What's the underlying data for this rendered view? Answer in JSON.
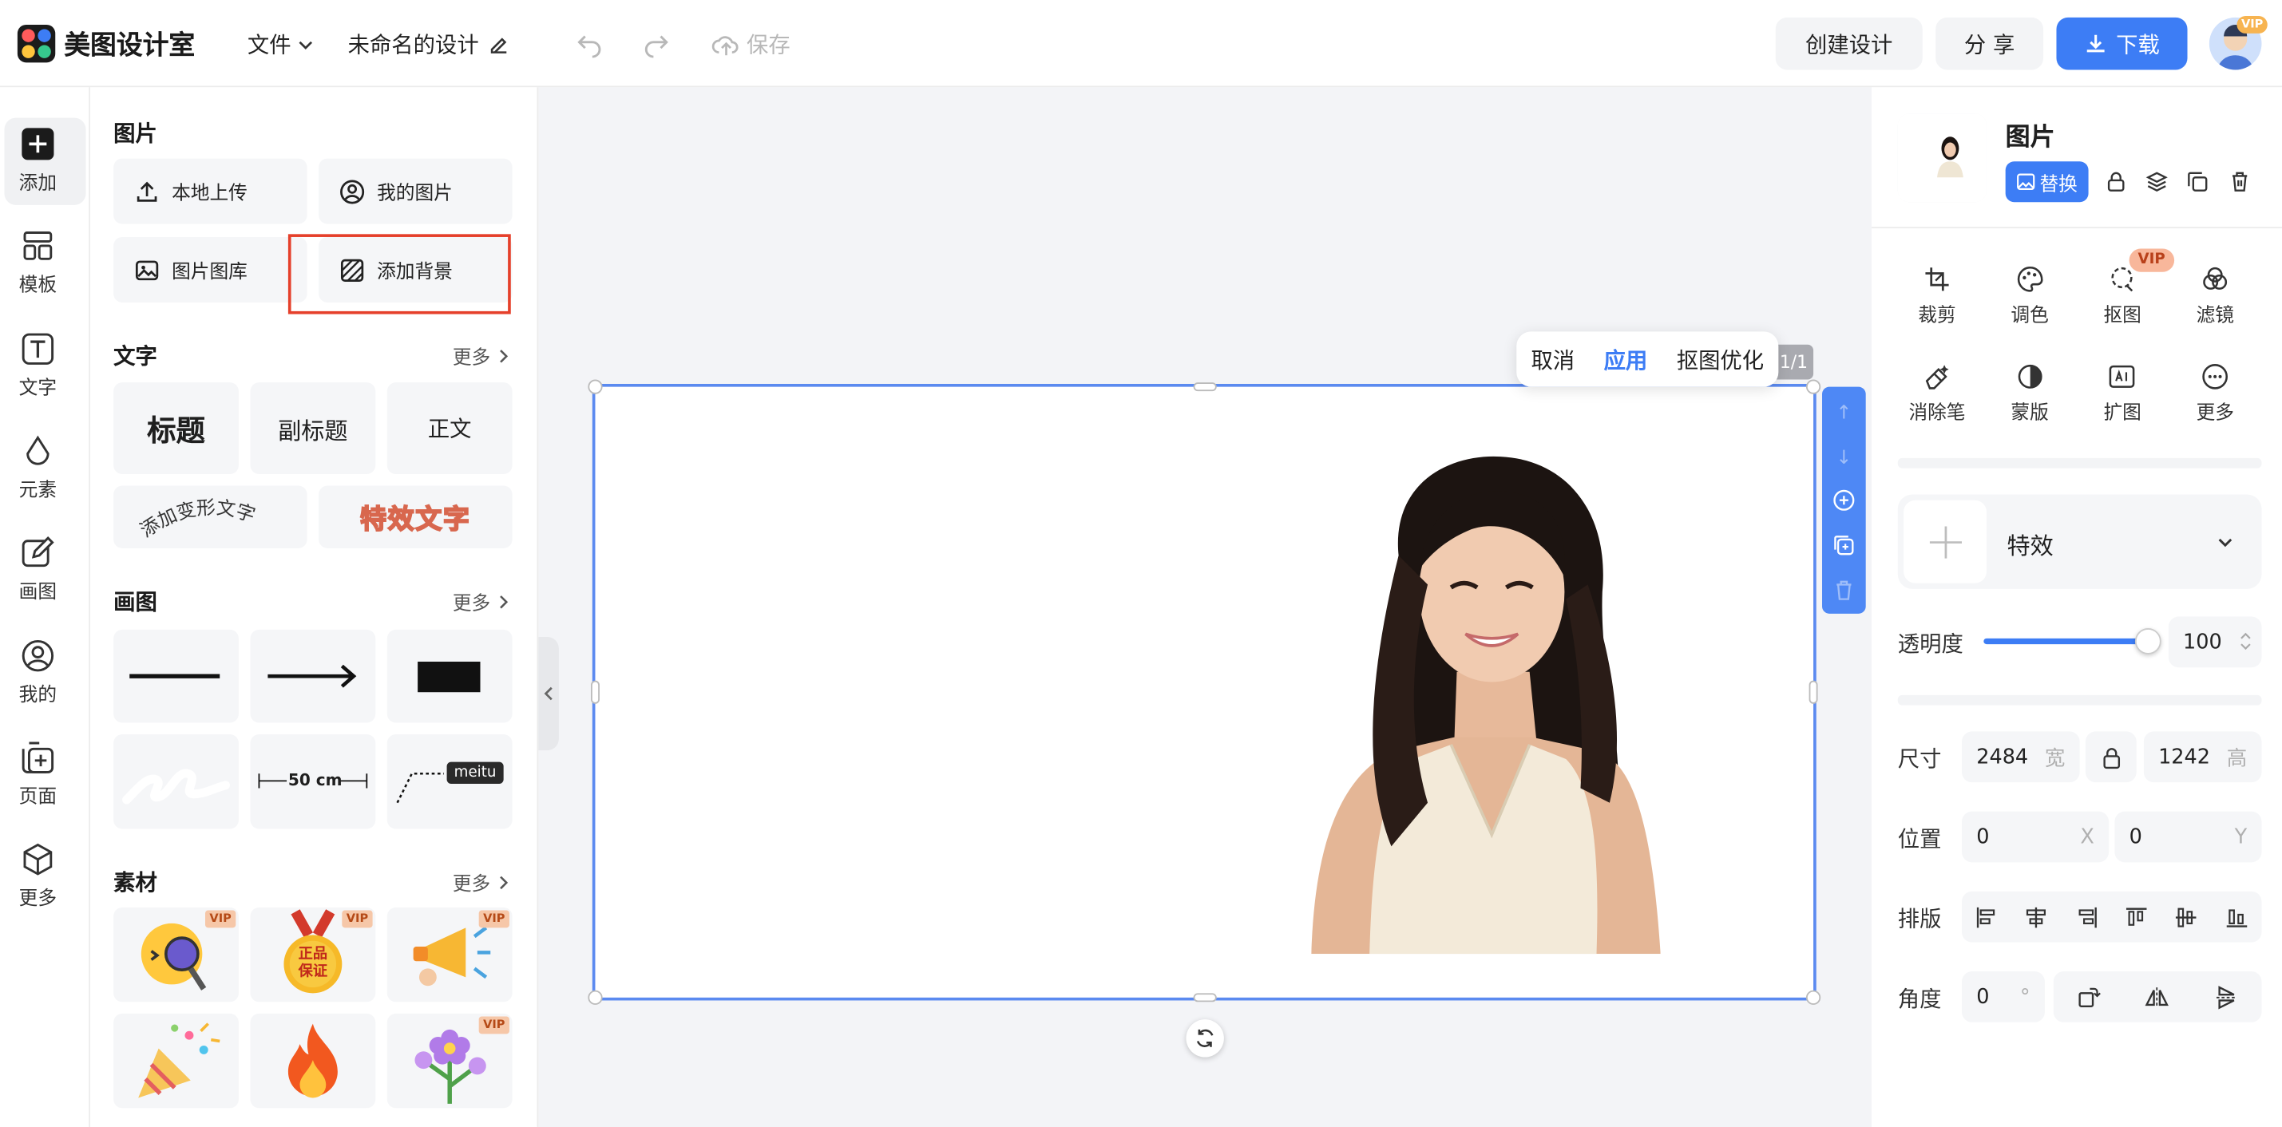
{
  "header": {
    "app_name": "美图设计室",
    "menu_file": "文件",
    "doc_title": "未命名的设计",
    "save_label": "保存",
    "create_label": "创建设计",
    "share_label": "分 享",
    "download_label": "下载",
    "avatar_badge": "VIP"
  },
  "rail": {
    "items": [
      {
        "label": "添加",
        "icon": "plus-icon",
        "active": true
      },
      {
        "label": "模板",
        "icon": "template-icon"
      },
      {
        "label": "文字",
        "icon": "text-icon"
      },
      {
        "label": "元素",
        "icon": "shapes-icon"
      },
      {
        "label": "画图",
        "icon": "draw-icon"
      },
      {
        "label": "我的",
        "icon": "user-icon"
      },
      {
        "label": "页面",
        "icon": "page-add-icon"
      },
      {
        "label": "更多",
        "icon": "box-icon"
      }
    ]
  },
  "panel": {
    "images_title": "图片",
    "upload_local": "本地上传",
    "my_images": "我的图片",
    "image_library": "图片图库",
    "add_background": "添加背景",
    "text_title": "文字",
    "more": "更多",
    "heading": "标题",
    "subheading": "副标题",
    "body": "正文",
    "warp_text": "添加变形文字",
    "effect_text": "特效文字",
    "draw_title": "画图",
    "measure_label": "50 cm",
    "meitu_tag": "meitu",
    "materials_title": "素材",
    "vip": "VIP",
    "badge_text_1": "正品",
    "badge_text_2": "保证"
  },
  "canvas": {
    "cancel": "取消",
    "apply": "应用",
    "optimize": "抠图优化",
    "page_indicator": "1/1"
  },
  "props": {
    "title": "图片",
    "replace": "替换",
    "tools": [
      {
        "label": "裁剪",
        "icon": "crop-icon"
      },
      {
        "label": "调色",
        "icon": "palette-icon"
      },
      {
        "label": "抠图",
        "icon": "cutout-icon",
        "badge": "VIP"
      },
      {
        "label": "滤镜",
        "icon": "filter-icon"
      },
      {
        "label": "消除笔",
        "icon": "eraser-icon"
      },
      {
        "label": "蒙版",
        "icon": "mask-icon"
      },
      {
        "label": "扩图",
        "icon": "expand-icon"
      },
      {
        "label": "更多",
        "icon": "more-icon"
      }
    ],
    "effects_label": "特效",
    "opacity_label": "透明度",
    "opacity_value": "100",
    "opacity_fraction": 1.0,
    "size_label": "尺寸",
    "width_value": "2484",
    "width_suffix": "宽",
    "height_value": "1242",
    "height_suffix": "高",
    "position_label": "位置",
    "x_value": "0",
    "x_suffix": "X",
    "y_value": "0",
    "y_suffix": "Y",
    "align_label": "排版",
    "angle_label": "角度",
    "angle_value": "0",
    "angle_suffix": "°"
  },
  "colors": {
    "accent": "#3d7df5",
    "highlight_box": "#e5402b",
    "selection": "#5b8af0"
  }
}
